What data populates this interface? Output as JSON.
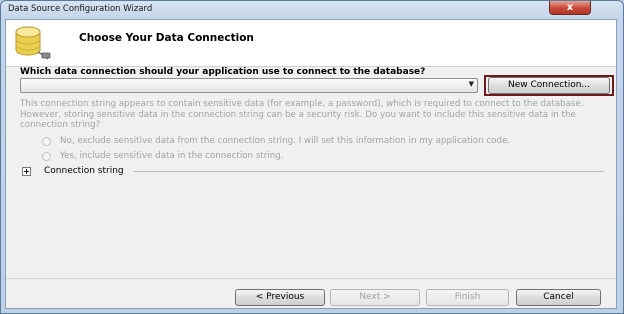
{
  "window": {
    "title": "Data Source Configuration Wizard",
    "close_glyph": "x"
  },
  "header": {
    "title": "Choose Your Data Connection",
    "icon": "database-icon"
  },
  "main": {
    "question": "Which data connection should your application use to connect to the database?",
    "connection_selected": "",
    "new_connection_label": "New Connection...",
    "info_text": "This connection string appears to contain sensitive data (for example, a password), which is required to connect to the database. However, storing sensitive data in the connection string can be a security risk. Do you want to include this sensitive data in the connection string?",
    "options": [
      {
        "label": "No, exclude sensitive data from the connection string. I will set this information in my application code.",
        "enabled": false
      },
      {
        "label": "Yes, include sensitive data in the connection string.",
        "enabled": false
      }
    ],
    "expander_glyph": "+",
    "connection_string_label": "Connection string"
  },
  "footer": {
    "previous_label": "< Previous",
    "next_label": "Next >",
    "finish_label": "Finish",
    "cancel_label": "Cancel"
  },
  "colors": {
    "title_bar": "#c4d6ea",
    "close_button": "#c7493a",
    "highlight_border": "#6e1a1a",
    "disabled_text": "#a3a3a3"
  }
}
